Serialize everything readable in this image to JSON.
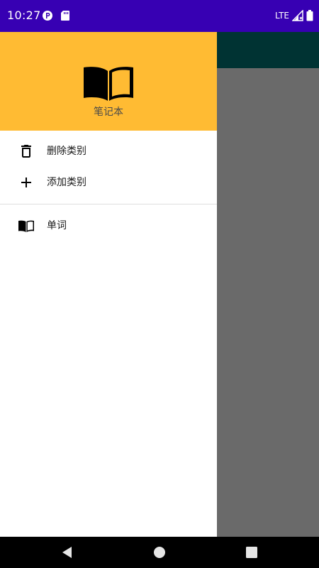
{
  "status_bar": {
    "time": "10:27",
    "network": "LTE",
    "left_icons": [
      "notification-p-icon",
      "sd-card-icon"
    ],
    "right_icons": [
      "signal-icon",
      "battery-icon"
    ],
    "color": "#3700b3"
  },
  "drawer": {
    "header": {
      "icon": "book-open-icon",
      "title": "笔记本",
      "color": "#ffbb33"
    },
    "actions": [
      {
        "icon": "trash-icon",
        "label": "删除类别"
      },
      {
        "icon": "plus-icon",
        "label": "添加类别"
      }
    ],
    "categories": [
      {
        "icon": "book-icon",
        "label": "单词"
      }
    ]
  },
  "app": {
    "toolbar_color": "#003333"
  },
  "nav_bar": {
    "buttons": [
      "back-icon",
      "home-icon",
      "recents-icon"
    ]
  }
}
